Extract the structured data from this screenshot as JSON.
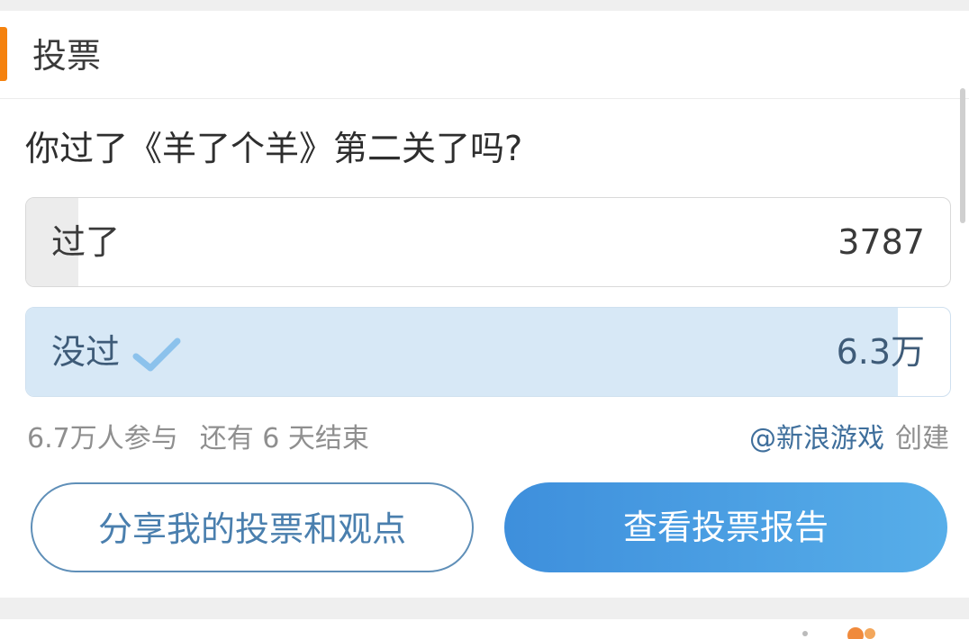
{
  "header": {
    "title": "投票"
  },
  "poll": {
    "question": "你过了《羊了个羊》第二关了吗?",
    "options": [
      {
        "label": "过了",
        "value": "3787",
        "fraction": 0.057,
        "selected": false
      },
      {
        "label": "没过",
        "value": "6.3万",
        "fraction": 0.943,
        "selected": true
      }
    ],
    "participants": "6.7万人参与",
    "remaining": "还有 6 天结束",
    "creator": "@新浪游戏",
    "creator_suffix": "创建"
  },
  "buttons": {
    "share": "分享我的投票和观点",
    "report": "查看投票报告"
  },
  "colors": {
    "accent": "#f5820e",
    "selected_fill": "#d7e8f6",
    "unselected_fill": "#ececec",
    "link": "#3f6f9c",
    "primary_button": "#4a9fe3"
  },
  "icons": {
    "selected": "check-icon"
  }
}
